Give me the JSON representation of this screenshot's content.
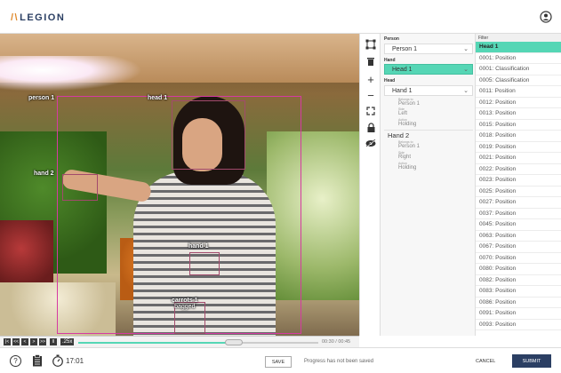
{
  "header": {
    "logo_mark": "/\\",
    "logo_text": "LEGION",
    "user_icon": "user-circle-icon"
  },
  "video": {
    "labels": {
      "person": "person 1",
      "head": "head 1",
      "hand2": "hand 2",
      "hand1": "hand 1",
      "carrots": "carrots 1",
      "carrots_sub": "bagged"
    }
  },
  "tools": [
    "bounding-box-icon",
    "trash-icon",
    "plus-icon",
    "minus-icon",
    "expand-icon",
    "lock-icon",
    "eye-slash-icon"
  ],
  "panel": {
    "person_section": "Person",
    "person_value": "Person 1",
    "hand_section": "Hand",
    "hand_value": "Head 1",
    "head_section": "Head",
    "head_value": "Hand 1",
    "hand1": {
      "title": "Hand 1",
      "f1_label": "Belongs to",
      "f1_value": "Person 1",
      "f2_label": "Side",
      "f2_value": "Left",
      "f3_label": "Action",
      "f3_value": "Holding"
    },
    "hand2": {
      "title": "Hand 2",
      "f1_label": "Belongs to",
      "f1_value": "Person 1",
      "f2_label": "Side",
      "f2_value": "Right",
      "f3_label": "Action",
      "f3_value": "Holding"
    }
  },
  "filter": {
    "header": "Filter",
    "items": [
      "Head 1",
      "0001: Position",
      "0001: Classification",
      "0005: Classification",
      "0011: Position",
      "0012: Position",
      "0013: Position",
      "0015: Position",
      "0018: Position",
      "0019: Position",
      "0021: Position",
      "0022: Position",
      "0023: Position",
      "0025: Position",
      "0027: Position",
      "0037: Position",
      "0045: Position",
      "0063: Position",
      "0067: Position",
      "0070: Position",
      "0080: Position",
      "0082: Position",
      "0083: Position",
      "0086: Position",
      "0091: Position",
      "0093: Position"
    ],
    "selected_index": 0
  },
  "timeline": {
    "controls": [
      "|<",
      "<<",
      "<",
      ">",
      ">>",
      ">|"
    ],
    "speed_icon": "II",
    "speed": ".25x",
    "progress": 0.62,
    "timecode": "00:30 / 00:45"
  },
  "footer": {
    "help": "?",
    "timer": "17:01",
    "save_label": "SAVE",
    "status": "Progress has not been saved",
    "cancel_label": "CANCEL",
    "submit_label": "SUBMIT"
  },
  "colors": {
    "accent": "#55d6b5",
    "brand": "#2b3f63",
    "bbox": "#d63aa2"
  }
}
